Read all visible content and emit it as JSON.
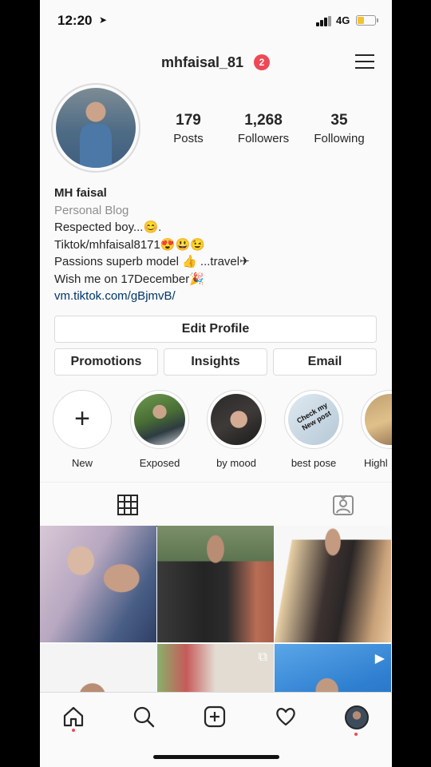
{
  "status_bar": {
    "time": "12:20",
    "location_icon": "location-arrow-icon",
    "network": "4G",
    "battery_color": "#f4c430"
  },
  "header": {
    "username": "mhfaisal_81",
    "notification_count": "2",
    "menu_icon": "hamburger-menu-icon"
  },
  "stats": {
    "posts": {
      "value": "179",
      "label": "Posts"
    },
    "followers": {
      "value": "1,268",
      "label": "Followers"
    },
    "following": {
      "value": "35",
      "label": "Following"
    }
  },
  "bio": {
    "name": "MH faisal",
    "category": "Personal Blog",
    "lines": [
      "Respected boy...😊.",
      "Tiktok/mhfaisal8171😍😃😉",
      "Passions superb model 👍 ...travel✈",
      "Wish me on 17December🎉"
    ],
    "link": "vm.tiktok.com/gBjmvB/"
  },
  "buttons": {
    "edit_profile": "Edit Profile",
    "promotions": "Promotions",
    "insights": "Insights",
    "email": "Email"
  },
  "highlights": [
    {
      "label": "New",
      "icon": "plus-icon"
    },
    {
      "label": "Exposed"
    },
    {
      "label": "by mood"
    },
    {
      "label": "best pose",
      "overlay_text": "Check my New post"
    },
    {
      "label": "Highl"
    }
  ],
  "tabs": [
    {
      "name": "grid",
      "icon": "grid-icon",
      "active": true
    },
    {
      "name": "tagged",
      "icon": "tagged-person-icon",
      "active": false
    }
  ],
  "bottom_nav": [
    {
      "name": "home",
      "icon": "home-icon",
      "has_dot": true
    },
    {
      "name": "search",
      "icon": "search-icon"
    },
    {
      "name": "new-post",
      "icon": "plus-square-icon"
    },
    {
      "name": "activity",
      "icon": "heart-icon"
    },
    {
      "name": "profile",
      "icon": "profile-avatar-icon",
      "has_dot": true
    }
  ],
  "colors": {
    "badge": "#ed4956",
    "link": "#003569",
    "muted": "#8e8e8e",
    "text": "#262626"
  }
}
